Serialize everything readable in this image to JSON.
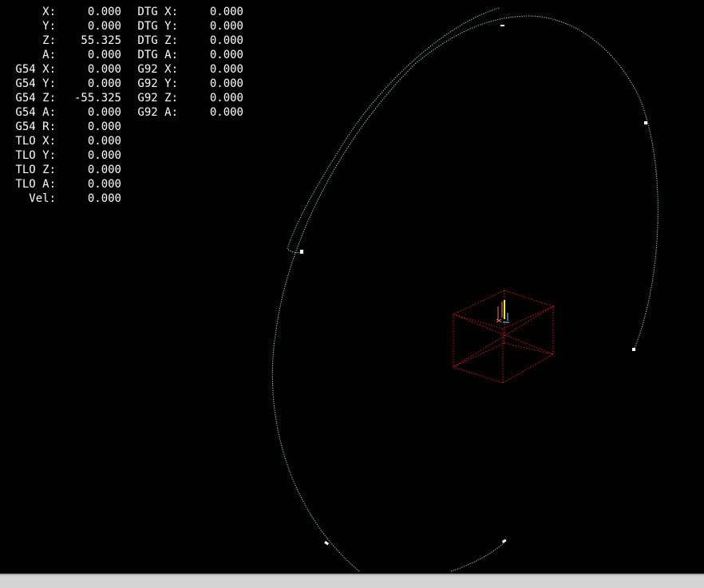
{
  "dro": {
    "rows": [
      {
        "label1": "X:",
        "value1": "0.000",
        "label2": "DTG X:",
        "value2": "0.000"
      },
      {
        "label1": "Y:",
        "value1": "0.000",
        "label2": "DTG Y:",
        "value2": "0.000"
      },
      {
        "label1": "Z:",
        "value1": "55.325",
        "label2": "DTG Z:",
        "value2": "0.000"
      },
      {
        "label1": "A:",
        "value1": "0.000",
        "label2": "DTG A:",
        "value2": "0.000"
      },
      {
        "label1": "G54 X:",
        "value1": "0.000",
        "label2": "G92 X:",
        "value2": "0.000"
      },
      {
        "label1": "G54 Y:",
        "value1": "0.000",
        "label2": "G92 Y:",
        "value2": "0.000"
      },
      {
        "label1": "G54 Z:",
        "value1": "-55.325",
        "label2": "G92 Z:",
        "value2": "0.000"
      },
      {
        "label1": "G54 A:",
        "value1": "0.000",
        "label2": "G92 A:",
        "value2": "0.000"
      },
      {
        "label1": "G54 R:",
        "value1": "0.000",
        "label2": "",
        "value2": ""
      },
      {
        "label1": "TLO X:",
        "value1": "0.000",
        "label2": "",
        "value2": ""
      },
      {
        "label1": "TLO Y:",
        "value1": "0.000",
        "label2": "",
        "value2": ""
      },
      {
        "label1": "TLO Z:",
        "value1": "0.000",
        "label2": "",
        "value2": ""
      },
      {
        "label1": "TLO A:",
        "value1": "0.000",
        "label2": "",
        "value2": ""
      },
      {
        "label1": "Vel:",
        "value1": "0.000",
        "label2": "",
        "value2": ""
      }
    ]
  },
  "colors": {
    "background": "#000000",
    "toolpath": "#9fe3e3",
    "extents_box": "#d21f1f",
    "tool": "#ffe600",
    "text": "#ffffff"
  },
  "icons": {
    "tool": "tool-marker-icon",
    "origin": "origin-axes-icon"
  }
}
